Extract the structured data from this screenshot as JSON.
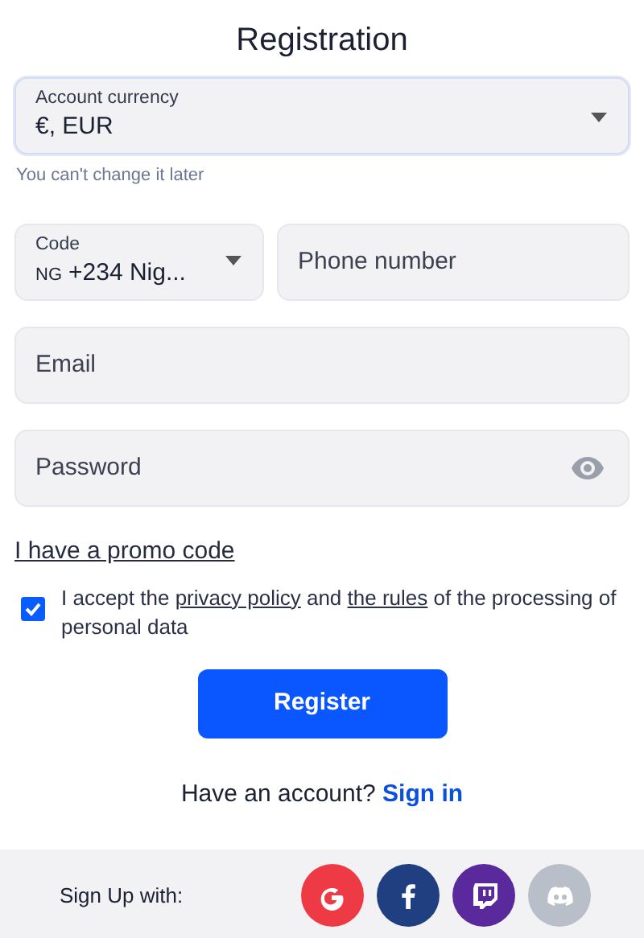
{
  "title": "Registration",
  "currency": {
    "label": "Account currency",
    "value": "€, EUR",
    "hint": "You can't change it later"
  },
  "phone": {
    "code_label": "Code",
    "flag": "NG",
    "code_value": "+234 Nig...",
    "placeholder": "Phone number"
  },
  "email": {
    "placeholder": "Email"
  },
  "password": {
    "placeholder": "Password"
  },
  "promo_link": "I have a promo code",
  "consent": {
    "checked": true,
    "parts": [
      {
        "kind": "text",
        "text": "I accept the "
      },
      {
        "kind": "link",
        "text": "privacy policy"
      },
      {
        "kind": "text",
        "text": " and "
      },
      {
        "kind": "link",
        "text": "the rules"
      },
      {
        "kind": "text",
        "text": " of the processing of personal data"
      }
    ]
  },
  "register_button": "Register",
  "signin": {
    "text": "Have an account?",
    "link": "Sign in"
  },
  "social": {
    "label": "Sign Up with:",
    "providers": [
      {
        "kind": "google",
        "color": "#ee3a44"
      },
      {
        "kind": "facebook",
        "color": "#203f80"
      },
      {
        "kind": "twitch",
        "color": "#5a2a9c"
      },
      {
        "kind": "discord",
        "color": "#b8bfc8"
      }
    ]
  }
}
